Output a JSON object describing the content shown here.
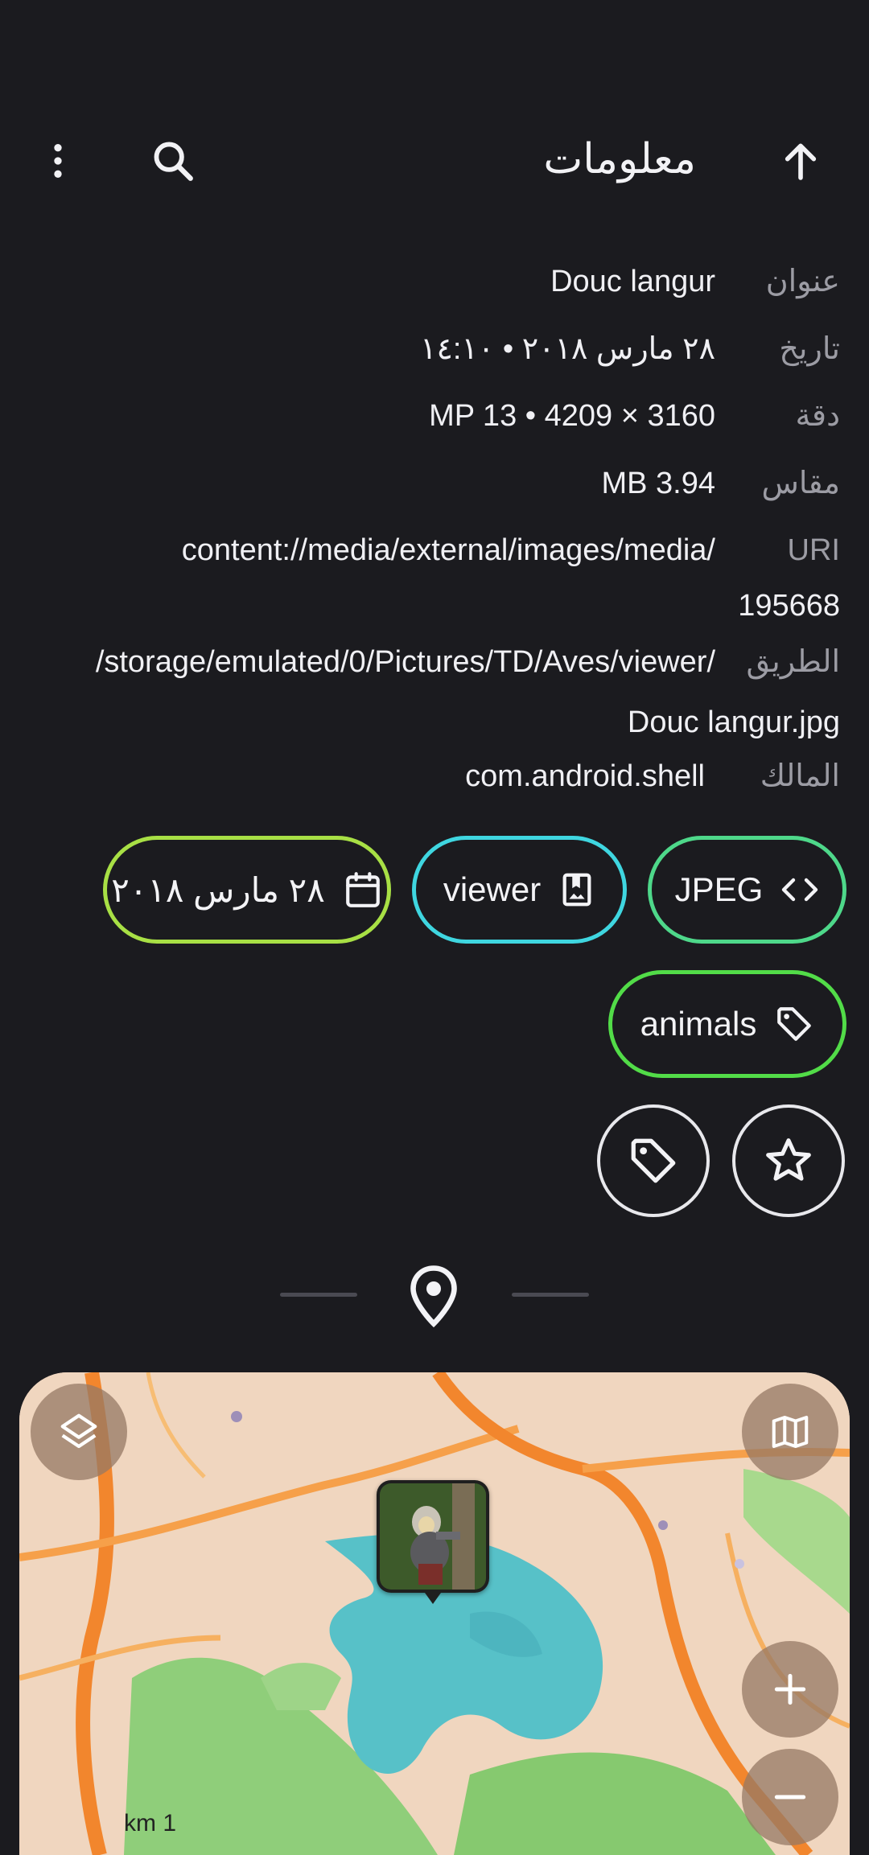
{
  "appbar": {
    "title": "معلومات",
    "icons": [
      "arrow-up-icon",
      "search-icon",
      "more-vert-icon"
    ]
  },
  "info": {
    "title_label": "عنوان",
    "title_value": "Douc langur",
    "date_label": "تاريخ",
    "date_value": "٢٨ مارس ٢٠١٨ • ١٤:١٠",
    "resolution_label": "دقة",
    "resolution_value": "MP 13 • 4209 × 3160",
    "size_label": "مقاس",
    "size_value": "MB 3.94",
    "uri_label": "URI",
    "uri_value_line1": "content://media/external/images/media/",
    "uri_value_line2": "195668",
    "path_label": "الطريق",
    "path_value_line1": "/storage/emulated/0/Pictures/TD/Aves/viewer/",
    "path_value_line2": "Douc langur.jpg",
    "owner_label": "المالك",
    "owner_value": "com.android.shell"
  },
  "chips": {
    "jpeg": "JPEG",
    "viewer": "viewer",
    "date": "٢٨ مارس ٢٠١٨",
    "animals": "animals"
  },
  "colors": {
    "background": "#1b1b1f",
    "chip_jpeg": "#4ed88a",
    "chip_viewer": "#3fd6e0",
    "chip_date": "#a8e045",
    "chip_animals": "#52dc48"
  },
  "map": {
    "scale_label": "km 1"
  }
}
